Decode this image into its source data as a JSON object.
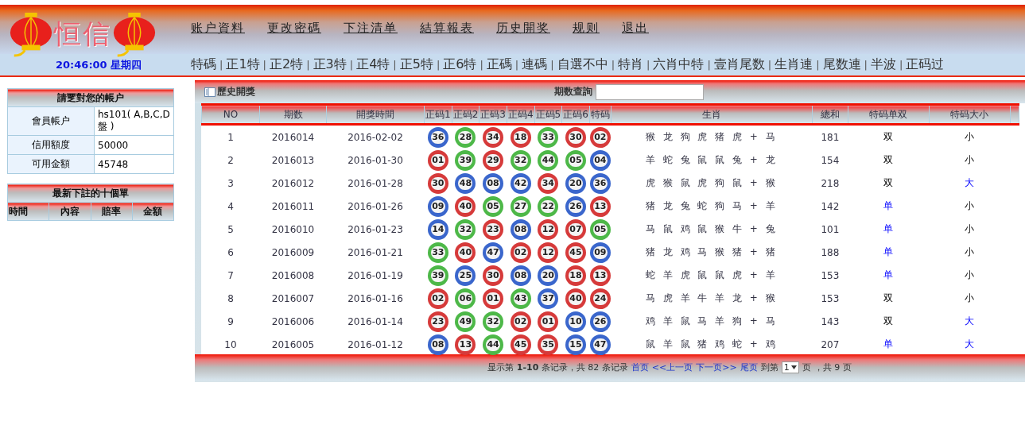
{
  "header": {
    "logo_text": "恒信",
    "nav": [
      "账户資料",
      "更改密碼",
      "下注清单",
      "結算報表",
      "历史開奖",
      "规则",
      "退出"
    ]
  },
  "clock": "20:46:00 星期四",
  "category_nav": [
    {
      "kind": "link",
      "label": "特碼"
    },
    {
      "kind": "separator",
      "label": "|"
    },
    {
      "kind": "link",
      "label": "正1特"
    },
    {
      "kind": "separator",
      "label": "|"
    },
    {
      "kind": "link",
      "label": "正2特"
    },
    {
      "kind": "separator",
      "label": "|"
    },
    {
      "kind": "link",
      "label": "正3特"
    },
    {
      "kind": "separator",
      "label": "|"
    },
    {
      "kind": "link",
      "label": "正4特"
    },
    {
      "kind": "separator",
      "label": "|"
    },
    {
      "kind": "link",
      "label": "正5特"
    },
    {
      "kind": "separator",
      "label": "|"
    },
    {
      "kind": "link",
      "label": "正6特"
    },
    {
      "kind": "separator",
      "label": "|"
    },
    {
      "kind": "link",
      "label": "正碼"
    },
    {
      "kind": "separator",
      "label": "|"
    },
    {
      "kind": "link",
      "label": "連碼"
    },
    {
      "kind": "separator",
      "label": "|"
    },
    {
      "kind": "link",
      "label": "自選不中"
    },
    {
      "kind": "separator",
      "label": "|"
    },
    {
      "kind": "link",
      "label": "特肖"
    },
    {
      "kind": "separator",
      "label": "|"
    },
    {
      "kind": "link",
      "label": "六肖中特"
    },
    {
      "kind": "separator",
      "label": "|"
    },
    {
      "kind": "link",
      "label": "壹肖尾数"
    },
    {
      "kind": "separator",
      "label": "|"
    },
    {
      "kind": "link",
      "label": "生肖連"
    },
    {
      "kind": "separator",
      "label": "|"
    },
    {
      "kind": "link",
      "label": "尾数連"
    },
    {
      "kind": "separator",
      "label": "|"
    },
    {
      "kind": "link",
      "label": "半波"
    },
    {
      "kind": "separator",
      "label": "|"
    },
    {
      "kind": "link",
      "label": "正码过"
    }
  ],
  "account": {
    "title": "請覂對您的帳户",
    "rows": [
      {
        "label": "會員帳户",
        "value": "hs101( A,B,C,D盤 )"
      },
      {
        "label": "信用額度",
        "value": "50000"
      },
      {
        "label": "可用金額",
        "value": "45748"
      }
    ]
  },
  "recent_bets": {
    "title": "最新下註的十個單",
    "columns": [
      "時間",
      "內容",
      "賠率",
      "金額"
    ]
  },
  "history": {
    "title": "歷史開獎",
    "search_label": "期数查詢",
    "columns": [
      "NO",
      "期数",
      "開獎時間",
      "正码1",
      "正码2",
      "正码3",
      "正码4",
      "正码5",
      "正码6",
      "特码",
      "生肖",
      "總和",
      "特码单双",
      "特码大小"
    ],
    "rows": [
      {
        "no": "1",
        "period": "2016014",
        "date": "2016-02-02",
        "balls": [
          {
            "number": "36",
            "color": "#3a66cc"
          },
          {
            "number": "28",
            "color": "#4db848"
          },
          {
            "number": "34",
            "color": "#d63a3a"
          },
          {
            "number": "18",
            "color": "#d63a3a"
          },
          {
            "number": "33",
            "color": "#4db848"
          },
          {
            "number": "30",
            "color": "#d63a3a"
          },
          {
            "number": "02",
            "color": "#d63a3a"
          }
        ],
        "zodiac": "猴 龙 狗 虎 猪 虎 + 马",
        "sum": "181",
        "odd_even": {
          "text": "双",
          "highlighted": false
        },
        "big_small": {
          "text": "小",
          "highlighted": false
        }
      },
      {
        "no": "2",
        "period": "2016013",
        "date": "2016-01-30",
        "balls": [
          {
            "number": "01",
            "color": "#d63a3a"
          },
          {
            "number": "39",
            "color": "#4db848"
          },
          {
            "number": "29",
            "color": "#d63a3a"
          },
          {
            "number": "32",
            "color": "#4db848"
          },
          {
            "number": "44",
            "color": "#4db848"
          },
          {
            "number": "05",
            "color": "#4db848"
          },
          {
            "number": "04",
            "color": "#3a66cc"
          }
        ],
        "zodiac": "羊 蛇 兔 鼠 鼠 兔 + 龙",
        "sum": "154",
        "odd_even": {
          "text": "双",
          "highlighted": false
        },
        "big_small": {
          "text": "小",
          "highlighted": false
        }
      },
      {
        "no": "3",
        "period": "2016012",
        "date": "2016-01-28",
        "balls": [
          {
            "number": "30",
            "color": "#d63a3a"
          },
          {
            "number": "48",
            "color": "#3a66cc"
          },
          {
            "number": "08",
            "color": "#3a66cc"
          },
          {
            "number": "42",
            "color": "#3a66cc"
          },
          {
            "number": "34",
            "color": "#d63a3a"
          },
          {
            "number": "20",
            "color": "#3a66cc"
          },
          {
            "number": "36",
            "color": "#3a66cc"
          }
        ],
        "zodiac": "虎 猴 鼠 虎 狗 鼠 + 猴",
        "sum": "218",
        "odd_even": {
          "text": "双",
          "highlighted": false
        },
        "big_small": {
          "text": "大",
          "highlighted": true
        }
      },
      {
        "no": "4",
        "period": "2016011",
        "date": "2016-01-26",
        "balls": [
          {
            "number": "09",
            "color": "#3a66cc"
          },
          {
            "number": "40",
            "color": "#d63a3a"
          },
          {
            "number": "05",
            "color": "#4db848"
          },
          {
            "number": "27",
            "color": "#4db848"
          },
          {
            "number": "22",
            "color": "#4db848"
          },
          {
            "number": "26",
            "color": "#3a66cc"
          },
          {
            "number": "13",
            "color": "#d63a3a"
          }
        ],
        "zodiac": "猪 龙 兔 蛇 狗 马 + 羊",
        "sum": "142",
        "odd_even": {
          "text": "单",
          "highlighted": true
        },
        "big_small": {
          "text": "小",
          "highlighted": false
        }
      },
      {
        "no": "5",
        "period": "2016010",
        "date": "2016-01-23",
        "balls": [
          {
            "number": "14",
            "color": "#3a66cc"
          },
          {
            "number": "32",
            "color": "#4db848"
          },
          {
            "number": "23",
            "color": "#d63a3a"
          },
          {
            "number": "08",
            "color": "#3a66cc"
          },
          {
            "number": "12",
            "color": "#d63a3a"
          },
          {
            "number": "07",
            "color": "#d63a3a"
          },
          {
            "number": "05",
            "color": "#4db848"
          }
        ],
        "zodiac": "马 鼠 鸡 鼠 猴 牛 + 兔",
        "sum": "101",
        "odd_even": {
          "text": "单",
          "highlighted": true
        },
        "big_small": {
          "text": "小",
          "highlighted": false
        }
      },
      {
        "no": "6",
        "period": "2016009",
        "date": "2016-01-21",
        "balls": [
          {
            "number": "33",
            "color": "#4db848"
          },
          {
            "number": "40",
            "color": "#d63a3a"
          },
          {
            "number": "47",
            "color": "#3a66cc"
          },
          {
            "number": "02",
            "color": "#d63a3a"
          },
          {
            "number": "12",
            "color": "#d63a3a"
          },
          {
            "number": "45",
            "color": "#d63a3a"
          },
          {
            "number": "09",
            "color": "#3a66cc"
          }
        ],
        "zodiac": "猪 龙 鸡 马 猴 猪 + 猪",
        "sum": "188",
        "odd_even": {
          "text": "单",
          "highlighted": true
        },
        "big_small": {
          "text": "小",
          "highlighted": false
        }
      },
      {
        "no": "7",
        "period": "2016008",
        "date": "2016-01-19",
        "balls": [
          {
            "number": "39",
            "color": "#4db848"
          },
          {
            "number": "25",
            "color": "#3a66cc"
          },
          {
            "number": "30",
            "color": "#d63a3a"
          },
          {
            "number": "08",
            "color": "#3a66cc"
          },
          {
            "number": "20",
            "color": "#3a66cc"
          },
          {
            "number": "18",
            "color": "#d63a3a"
          },
          {
            "number": "13",
            "color": "#d63a3a"
          }
        ],
        "zodiac": "蛇 羊 虎 鼠 鼠 虎 + 羊",
        "sum": "153",
        "odd_even": {
          "text": "单",
          "highlighted": true
        },
        "big_small": {
          "text": "小",
          "highlighted": false
        }
      },
      {
        "no": "8",
        "period": "2016007",
        "date": "2016-01-16",
        "balls": [
          {
            "number": "02",
            "color": "#d63a3a"
          },
          {
            "number": "06",
            "color": "#4db848"
          },
          {
            "number": "01",
            "color": "#d63a3a"
          },
          {
            "number": "43",
            "color": "#4db848"
          },
          {
            "number": "37",
            "color": "#3a66cc"
          },
          {
            "number": "40",
            "color": "#d63a3a"
          },
          {
            "number": "24",
            "color": "#d63a3a"
          }
        ],
        "zodiac": "马 虎 羊 牛 羊 龙 + 猴",
        "sum": "153",
        "odd_even": {
          "text": "双",
          "highlighted": false
        },
        "big_small": {
          "text": "小",
          "highlighted": false
        }
      },
      {
        "no": "9",
        "period": "2016006",
        "date": "2016-01-14",
        "balls": [
          {
            "number": "23",
            "color": "#d63a3a"
          },
          {
            "number": "49",
            "color": "#4db848"
          },
          {
            "number": "32",
            "color": "#4db848"
          },
          {
            "number": "02",
            "color": "#d63a3a"
          },
          {
            "number": "01",
            "color": "#d63a3a"
          },
          {
            "number": "10",
            "color": "#3a66cc"
          },
          {
            "number": "26",
            "color": "#3a66cc"
          }
        ],
        "zodiac": "鸡 羊 鼠 马 羊 狗 + 马",
        "sum": "143",
        "odd_even": {
          "text": "双",
          "highlighted": false
        },
        "big_small": {
          "text": "大",
          "highlighted": true
        }
      },
      {
        "no": "10",
        "period": "2016005",
        "date": "2016-01-12",
        "balls": [
          {
            "number": "08",
            "color": "#3a66cc"
          },
          {
            "number": "13",
            "color": "#d63a3a"
          },
          {
            "number": "44",
            "color": "#4db848"
          },
          {
            "number": "45",
            "color": "#d63a3a"
          },
          {
            "number": "35",
            "color": "#d63a3a"
          },
          {
            "number": "15",
            "color": "#3a66cc"
          },
          {
            "number": "47",
            "color": "#3a66cc"
          }
        ],
        "zodiac": "鼠 羊 鼠 猪 鸡 蛇 + 鸡",
        "sum": "207",
        "odd_even": {
          "text": "单",
          "highlighted": true
        },
        "big_small": {
          "text": "大",
          "highlighted": true
        }
      }
    ],
    "pager": {
      "summary": "显示第 **1-10** 条记录，共 82 条记录",
      "links": [
        "首页",
        "<<上一页",
        "下一页>>",
        "尾页"
      ],
      "goto_label": "到第",
      "page_value": "1",
      "page_unit": "页",
      "total": "，共 9 页"
    }
  }
}
